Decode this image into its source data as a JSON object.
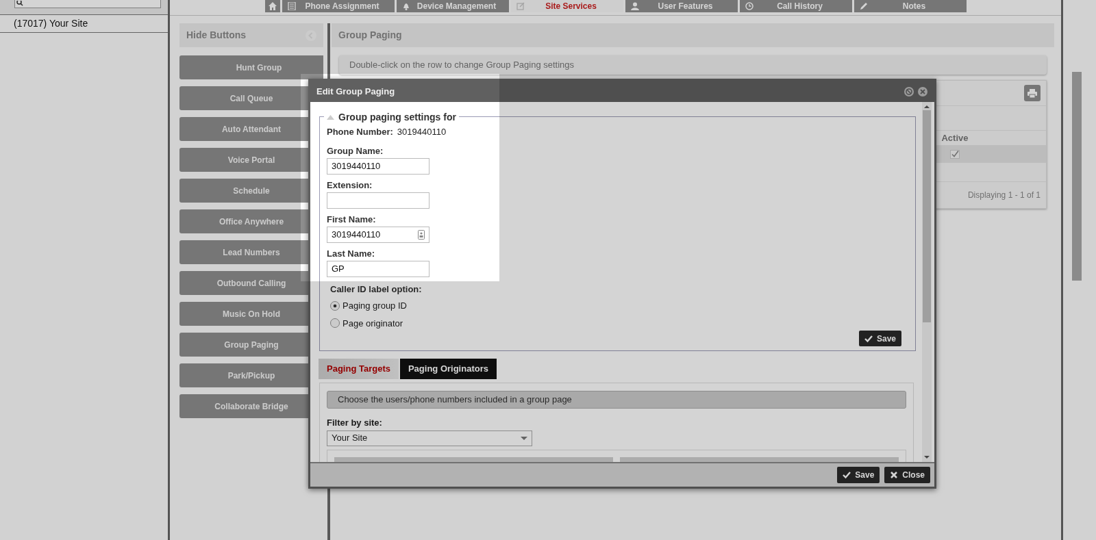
{
  "left_panel": {
    "items": [
      {
        "label": "(17017) Your Site"
      }
    ]
  },
  "nav_tabs": [
    {
      "kind": "home",
      "selected": false
    },
    {
      "kind": "list",
      "label": "Phone Assignment",
      "selected": false
    },
    {
      "kind": "bell",
      "label": "Device Management",
      "selected": false
    },
    {
      "kind": "edit",
      "label": "Site Services",
      "selected": true
    },
    {
      "kind": "person",
      "label": "User Features",
      "selected": false
    },
    {
      "kind": "clock",
      "label": "Call History",
      "selected": false
    },
    {
      "kind": "pencil",
      "label": "Notes",
      "selected": false
    }
  ],
  "sidebar": {
    "title": "Hide Buttons",
    "buttons": [
      "Hunt Group",
      "Call Queue",
      "Auto Attendant",
      "Voice Portal",
      "Schedule",
      "Office Anywhere",
      "Lead Numbers",
      "Outbound Calling",
      "Music On Hold",
      "Group Paging",
      "Park/Pickup",
      "Collaborate Bridge"
    ]
  },
  "content": {
    "title": "Group Paging",
    "hint": "Double-click on the row to change Group Paging settings"
  },
  "grid": {
    "columns": [
      "Active"
    ],
    "rows": [
      {
        "active": true,
        "selected": true
      }
    ],
    "footer": "Displaying 1 - 1 of 1"
  },
  "dialog": {
    "title": "Edit Group Paging",
    "legend": "Group paging settings for",
    "phone_label": "Phone Number:",
    "phone_value": "3019440110",
    "fields": [
      {
        "kind": "text",
        "label": "Group Name:",
        "value": "3019440110"
      },
      {
        "kind": "text",
        "label": "Extension:"
      },
      {
        "kind": "contact",
        "label": "First Name:",
        "value": "3019440110"
      },
      {
        "kind": "text",
        "label": "Last Name:",
        "value": "GP"
      }
    ],
    "caller_id": {
      "label": "Caller ID label option:",
      "options": [
        {
          "label": "Paging group ID",
          "selected": true
        },
        {
          "label": "Page originator",
          "selected": false
        }
      ]
    },
    "save": "Save",
    "tabs": [
      {
        "label": "Paging Targets",
        "selected": true
      },
      {
        "label": "Paging Originators",
        "selected": false
      }
    ],
    "panel": {
      "hint": "Choose the users/phone numbers included in a group page",
      "filter_label": "Filter by site:",
      "filter_value": "Your Site"
    },
    "buttons": [
      {
        "kind": "save",
        "label": "Save"
      },
      {
        "kind": "close",
        "label": "Close"
      }
    ]
  }
}
